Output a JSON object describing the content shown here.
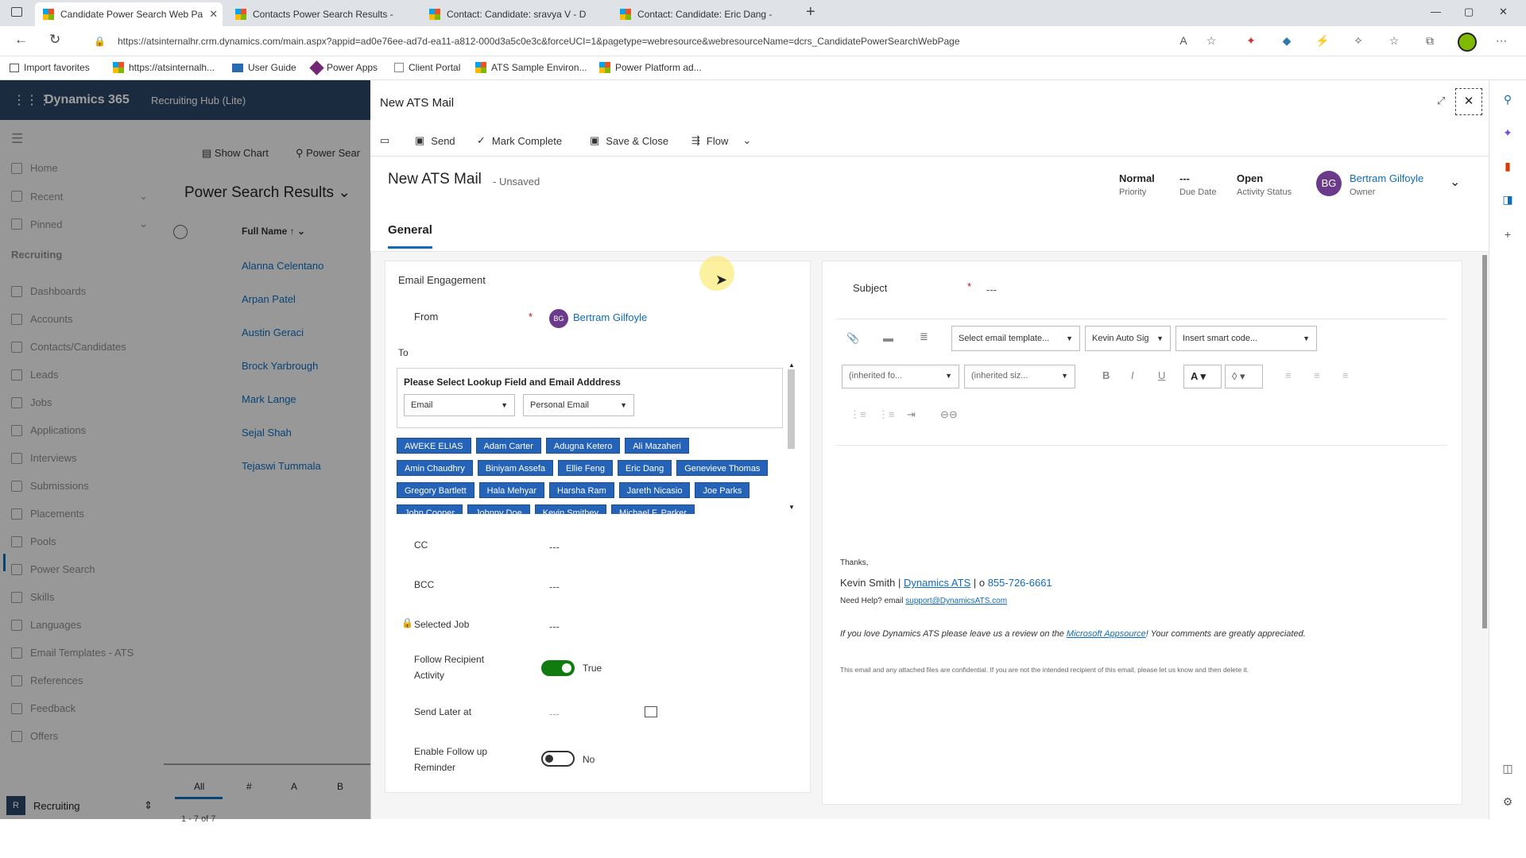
{
  "browser": {
    "tabs": [
      {
        "title": "Candidate Power Search Web Pa",
        "close": "✕"
      },
      {
        "title": "Contacts Power Search Results -"
      },
      {
        "title": "Contact: Candidate: sravya V - D"
      },
      {
        "title": "Contact: Candidate: Eric Dang - "
      }
    ],
    "new_tab": "+",
    "url": "https://atsinternalhr.crm.dynamics.com/main.aspx?appid=ad0e76ee-ad7d-ea11-a812-000d3a5c0e3c&forceUCI=1&pagetype=webresource&webresourceName=dcrs_CandidatePowerSearchWebPage",
    "favorites": [
      "Import favorites",
      "https://atsinternalh...",
      "User Guide",
      "Power Apps",
      "Client Portal",
      "ATS Sample Environ...",
      "Power Platform ad..."
    ],
    "window_controls": [
      "—",
      "▢",
      "✕"
    ]
  },
  "app": {
    "name": "Dynamics 365",
    "area": "Recruiting Hub (Lite)"
  },
  "nav": {
    "items": [
      "Home",
      "Recent",
      "Pinned"
    ],
    "section": "Recruiting",
    "recruiting": [
      "Dashboards",
      "Accounts",
      "Contacts/Candidates",
      "Leads",
      "Jobs",
      "Applications",
      "Interviews",
      "Submissions",
      "Placements",
      "Pools",
      "Power Search",
      "Skills",
      "Languages",
      "Email Templates - ATS",
      "References",
      "Feedback",
      "Offers"
    ],
    "area_switch": "Recruiting",
    "area_badge": "R"
  },
  "list": {
    "show_chart": "Show Chart",
    "power_search": "Power Sear",
    "title": "Power Search Results",
    "column": "Full Name",
    "rows": [
      "Alanna Celentano",
      "Arpan Patel",
      "Austin Geraci",
      "Brock Yarbrough",
      "Mark Lange",
      "Sejal Shah",
      "Tejaswi Tummala"
    ],
    "alpha": [
      "All",
      "#",
      "A",
      "B"
    ],
    "count": "1 - 7 of 7"
  },
  "panel": {
    "title": "New ATS Mail",
    "commands": [
      "Send",
      "Mark Complete",
      "Save & Close",
      "Flow"
    ],
    "form_title": "New ATS Mail",
    "unsaved": "- Unsaved",
    "header_fields": [
      {
        "value": "Normal",
        "label": "Priority"
      },
      {
        "value": "---",
        "label": "Due Date"
      },
      {
        "value": "Open",
        "label": "Activity Status"
      }
    ],
    "owner": {
      "initials": "BG",
      "name": "Bertram Gilfoyle",
      "label": "Owner"
    },
    "tab": "General",
    "left": {
      "section": "Email Engagement",
      "from_label": "From",
      "from_initials": "BG",
      "from_value": "Bertram Gilfoyle",
      "to_label": "To",
      "lookup_title": "Please Select Lookup Field and Email Adddress",
      "lookup_field": "Email",
      "lookup_email": "Personal Email",
      "recipients": [
        "AWEKE ELIAS",
        "Adam Carter",
        "Adugna Ketero",
        "Ali Mazaheri",
        "Amin Chaudhry",
        "Biniyam Assefa",
        "Ellie Feng",
        "Eric Dang",
        "Genevieve Thomas",
        "Gregory Bartlett",
        "Hala Mehyar",
        "Harsha Ram",
        "Jareth Nicasio",
        "Joe Parks",
        "John Cooper",
        "Johnny Doe",
        "Kevin Smithey",
        "Michael F. Parker"
      ],
      "cc_label": "CC",
      "cc_value": "---",
      "bcc_label": "BCC",
      "bcc_value": "---",
      "job_label": "Selected Job",
      "job_value": "---",
      "follow_label_1": "Follow Recipient",
      "follow_label_2": "Activity",
      "follow_value": "True",
      "send_later_label": "Send Later at",
      "send_later_value": "---",
      "enable_label_1": "Enable Follow up",
      "enable_label_2": "Reminder",
      "enable_value": "No"
    },
    "right": {
      "subject_label": "Subject",
      "subject_value": "---",
      "template": "Select email template...",
      "signature": "Kevin Auto Sig",
      "smart_code": "Insert smart code...",
      "font": "(inherited fo...",
      "size": "(inherited siz...",
      "body": {
        "thanks": "Thanks,",
        "sig_name": "Kevin Smith | ",
        "sig_company": "Dynamics ATS",
        "sig_phone_pre": " | o  ",
        "sig_phone": "855-726-6661",
        "help": "Need Help? email ",
        "help_email": "support@DynamicsATS.com",
        "review_pre": "If you love Dynamics ATS please leave us a review on the ",
        "review_link": "Microsoft Appsource",
        "review_post": "!  Your comments are greatly appreciated.",
        "conf": "This email and any attached files are confidential. If you are not the intended recipient of this email, please let us know and then delete it."
      }
    }
  },
  "colors": {
    "accent": "#0f6cbd",
    "chip": "#2563b8",
    "d365": "#2a4668",
    "owner_avatar": "#6b3a8a",
    "toggle_on": "#107c10"
  }
}
